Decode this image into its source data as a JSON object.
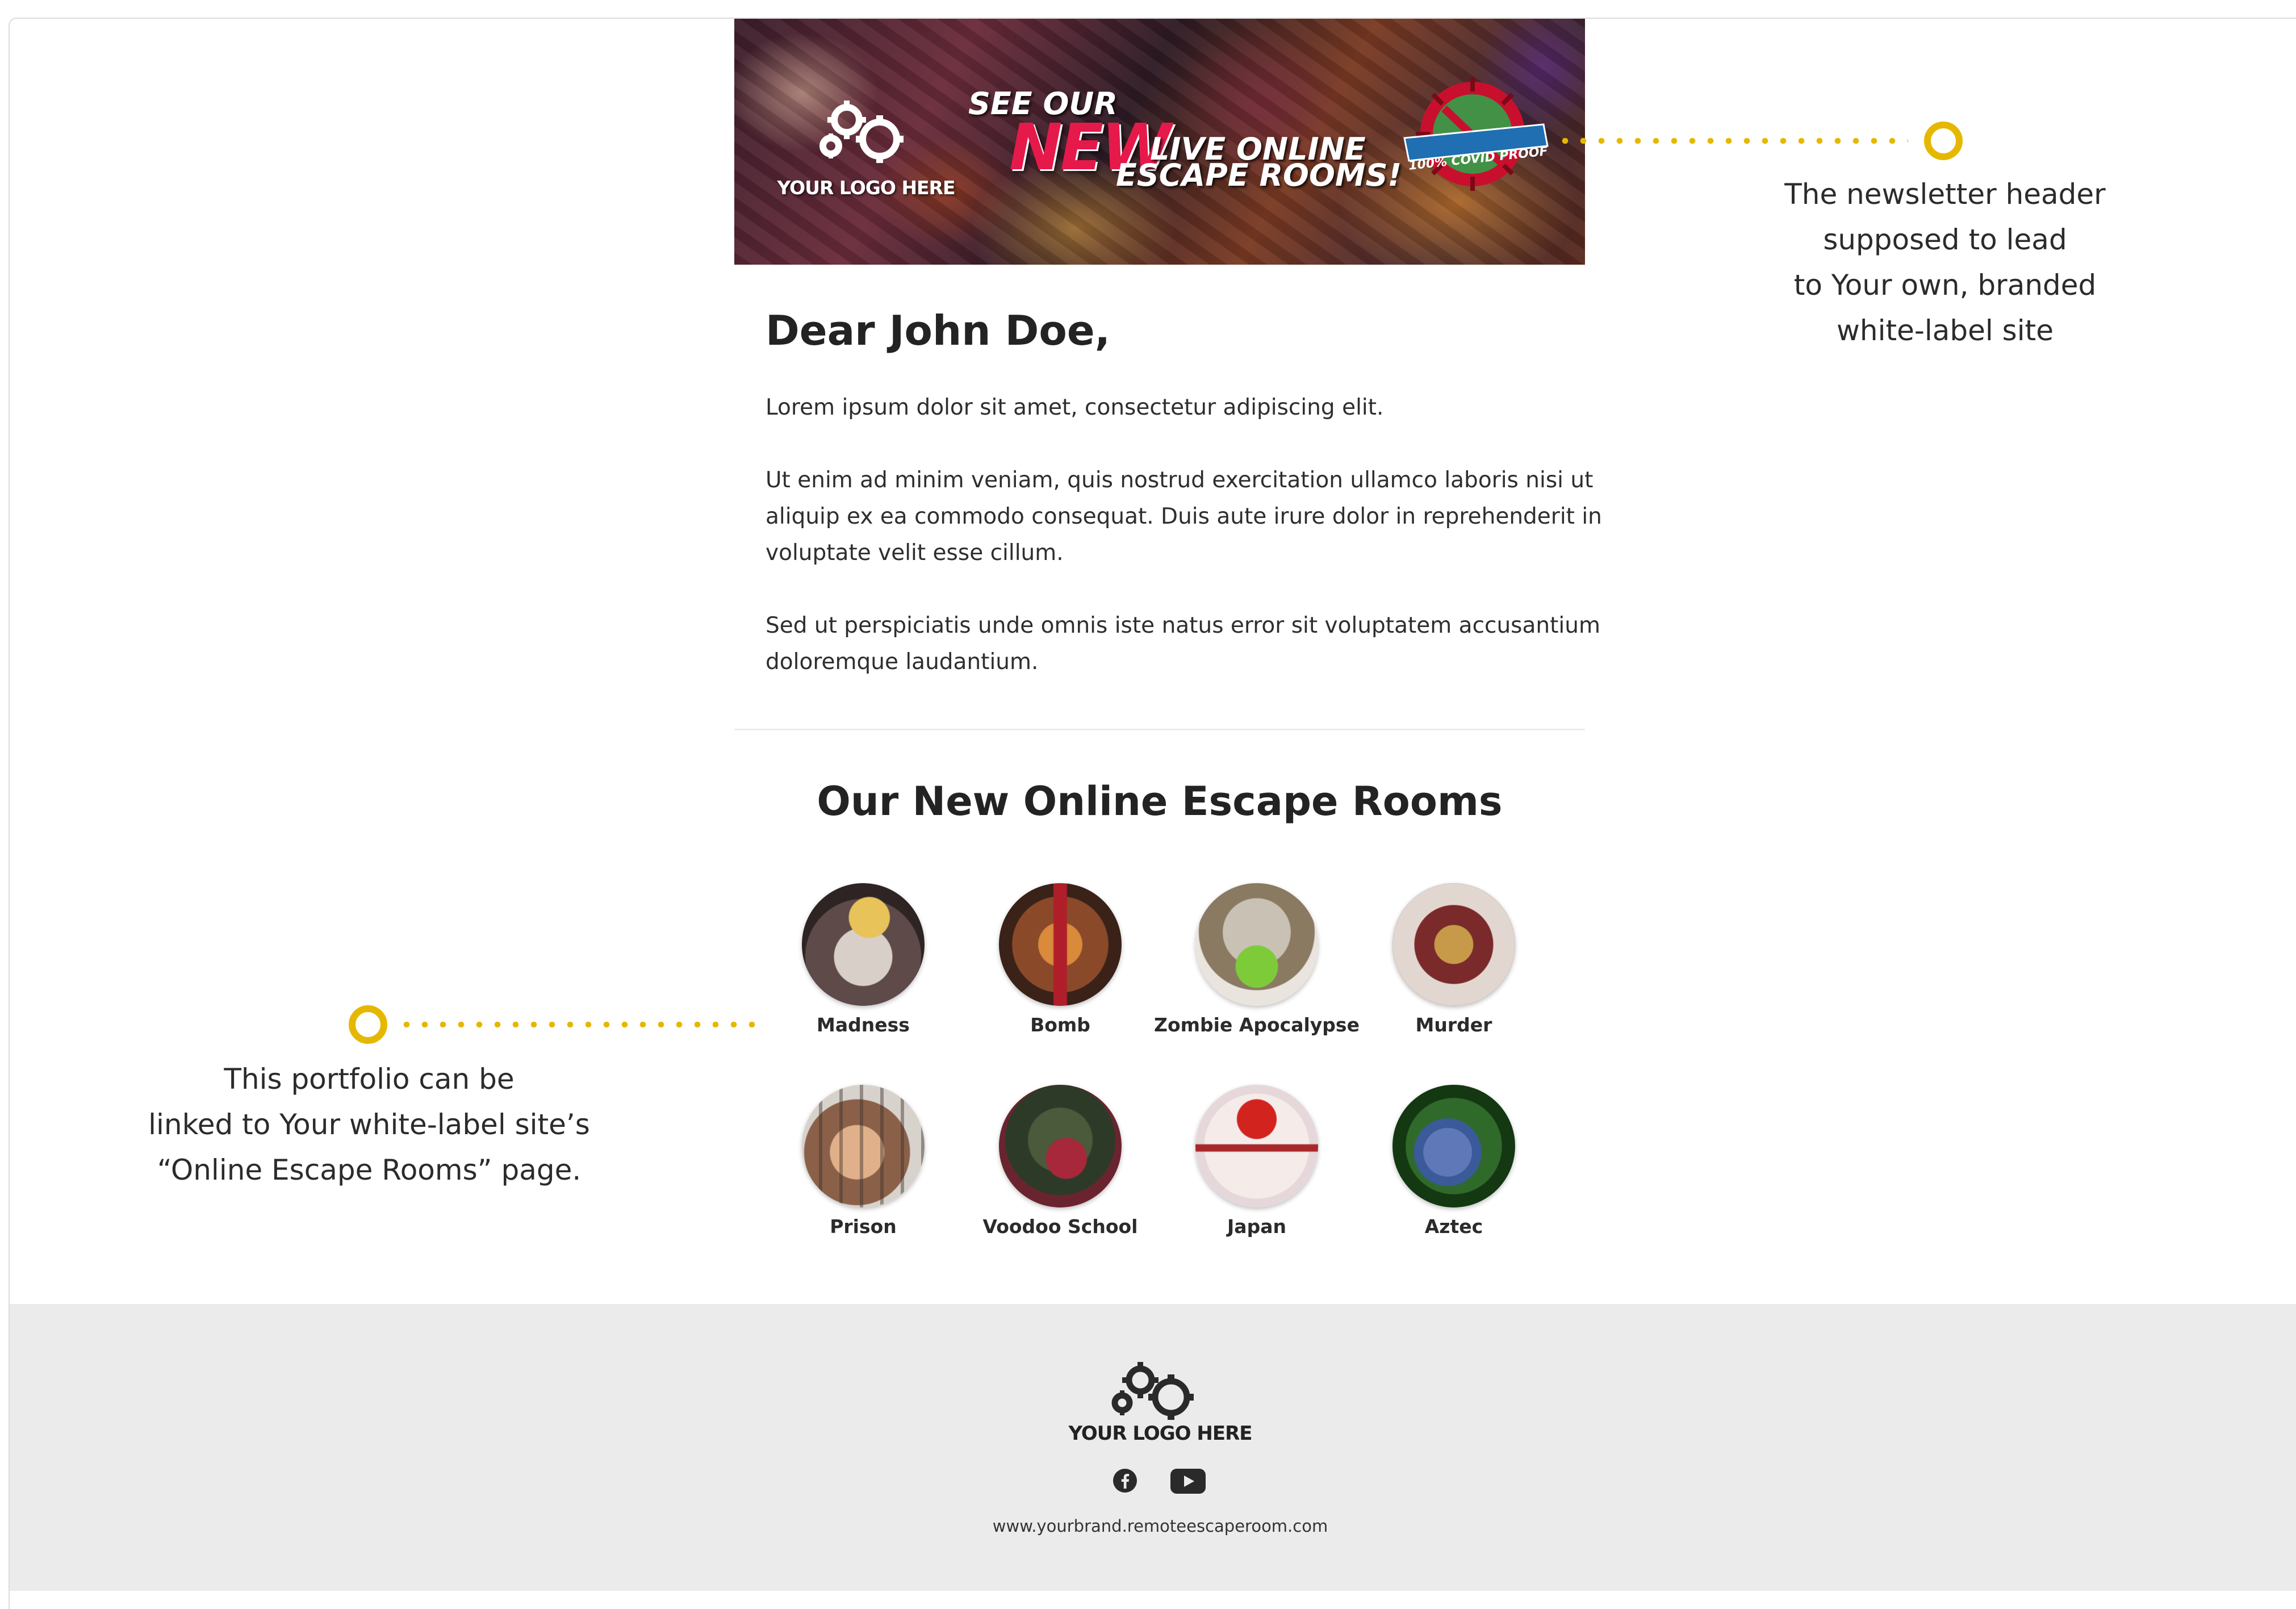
{
  "banner": {
    "logo_text": "YOUR LOGO HERE",
    "line1": "SEE OUR",
    "line2_highlight": "NEW",
    "line3": "LIVE ONLINE",
    "line4": "ESCAPE ROOMS!",
    "badge_text": "100% COVID PROOF"
  },
  "annotations": {
    "header": {
      "lines": [
        "The newsletter header",
        "supposed to lead",
        "to Your own, branded",
        "white-label site"
      ]
    },
    "portfolio": {
      "lines": [
        "This portfolio can be",
        "linked to Your white-label site’s",
        "“Online Escape Rooms” page."
      ]
    }
  },
  "letter": {
    "greeting": "Dear John Doe,",
    "paragraphs": [
      [
        "Lorem ipsum dolor sit amet, consectetur adipiscing elit."
      ],
      [
        "Ut enim ad minim veniam, quis nostrud exercitation ullamco laboris nisi ut",
        "aliquip ex ea commodo consequat. Duis aute irure dolor in reprehenderit in",
        "voluptate velit esse cillum."
      ],
      [
        "Sed ut perspiciatis unde omnis iste natus error sit voluptatem accusantium",
        "doloremque laudantium."
      ]
    ]
  },
  "rooms_section": {
    "title": "Our New Online Escape Rooms",
    "rooms": [
      {
        "name": "Madness"
      },
      {
        "name": "Bomb"
      },
      {
        "name": "Zombie Apocalypse"
      },
      {
        "name": "Murder"
      },
      {
        "name": "Prison"
      },
      {
        "name": "Voodoo School"
      },
      {
        "name": "Japan"
      },
      {
        "name": "Aztec"
      }
    ]
  },
  "footer": {
    "logo_text": "YOUR LOGO HERE",
    "social": [
      {
        "icon": "facebook-icon"
      },
      {
        "icon": "youtube-icon"
      }
    ],
    "url": "www.yourbrand.remoteescaperoom.com"
  },
  "colors": {
    "accent": "#e5b800",
    "banner_highlight": "#e6194b",
    "footer_bg": "#ebebeb"
  }
}
